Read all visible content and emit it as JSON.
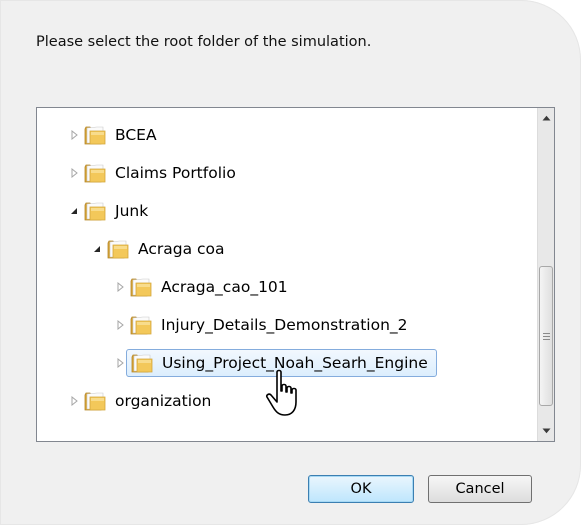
{
  "dialog": {
    "prompt": "Please select the root folder of the simulation.",
    "tree": {
      "items": [
        {
          "label": "BCEA",
          "depth": 0,
          "expander": "collapsed"
        },
        {
          "label": "Claims Portfolio",
          "depth": 0,
          "expander": "collapsed"
        },
        {
          "label": "Junk",
          "depth": 0,
          "expander": "expanded"
        },
        {
          "label": "Acraga coa",
          "depth": 1,
          "expander": "expanded"
        },
        {
          "label": "Acraga_cao_101",
          "depth": 2,
          "expander": "collapsed"
        },
        {
          "label": "Injury_Details_Demonstration_2",
          "depth": 2,
          "expander": "collapsed"
        },
        {
          "label": "Using_Project_Noah_Searh_Engine",
          "depth": 2,
          "expander": "collapsed",
          "selected": true
        },
        {
          "label": "organization",
          "depth": 0,
          "expander": "collapsed"
        }
      ],
      "icons": {
        "folder": "folder-icon",
        "collapsed": "expand-arrow-icon",
        "expanded": "collapse-arrow-icon"
      },
      "scrollbar": {
        "up_icon": "scroll-up-arrow-icon",
        "down_icon": "scroll-down-arrow-icon"
      }
    },
    "buttons": {
      "ok_label": "OK",
      "cancel_label": "Cancel"
    }
  },
  "cursor": {
    "icon": "hand-pointer-icon"
  },
  "colors": {
    "dialog_bg": "#f0f0f0",
    "selection_border": "#84acdd",
    "selection_fill": "#dceefd",
    "folder_yellow": "#f3c85a",
    "ok_border": "#3c7fb1"
  }
}
